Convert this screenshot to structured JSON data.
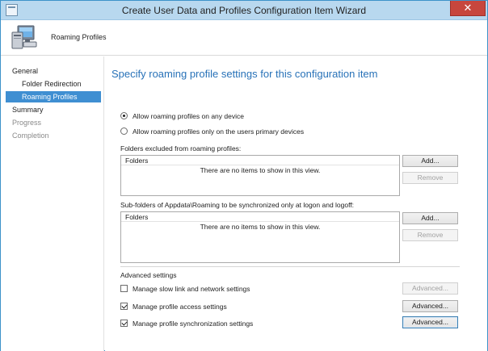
{
  "window": {
    "title": "Create User Data and Profiles Configuration Item Wizard",
    "close_glyph": "✕"
  },
  "header": {
    "icon": "computer-monitor-icon",
    "text": "Roaming Profiles"
  },
  "nav": {
    "items": [
      {
        "label": "General",
        "state": "normal"
      },
      {
        "label": "Folder Redirection",
        "state": "normal"
      },
      {
        "label": "Roaming Profiles",
        "state": "selected"
      },
      {
        "label": "Summary",
        "state": "normal"
      },
      {
        "label": "Progress",
        "state": "disabled"
      },
      {
        "label": "Completion",
        "state": "disabled"
      }
    ]
  },
  "main": {
    "heading": "Specify roaming profile settings for this configuration item",
    "radio_any": {
      "label": "Allow roaming profiles on any device",
      "checked": true
    },
    "radio_primary": {
      "label": "Allow roaming profiles only on the users primary devices",
      "checked": false
    },
    "excluded": {
      "label": "Folders excluded from roaming profiles:",
      "column": "Folders",
      "empty_text": "There are no items to show in this view.",
      "add_label": "Add...",
      "remove_label": "Remove"
    },
    "synced": {
      "label": "Sub-folders of Appdata\\Roaming to be synchronized only at logon and logoff:",
      "column": "Folders",
      "empty_text": "There are no items to show in this view.",
      "add_label": "Add...",
      "remove_label": "Remove"
    },
    "advanced": {
      "label": "Advanced settings",
      "rows": [
        {
          "label": "Manage slow link and network settings",
          "checked": false,
          "button": "Advanced...",
          "button_enabled": false
        },
        {
          "label": "Manage profile access settings",
          "checked": true,
          "button": "Advanced...",
          "button_enabled": true
        },
        {
          "label": "Manage profile synchronization settings",
          "checked": true,
          "button": "Advanced...",
          "button_enabled": true
        }
      ]
    }
  },
  "colors": {
    "accent": "#2872b8",
    "selection": "#3f8fd2",
    "titlebar": "#b8d8ef",
    "close": "#c7463d"
  }
}
